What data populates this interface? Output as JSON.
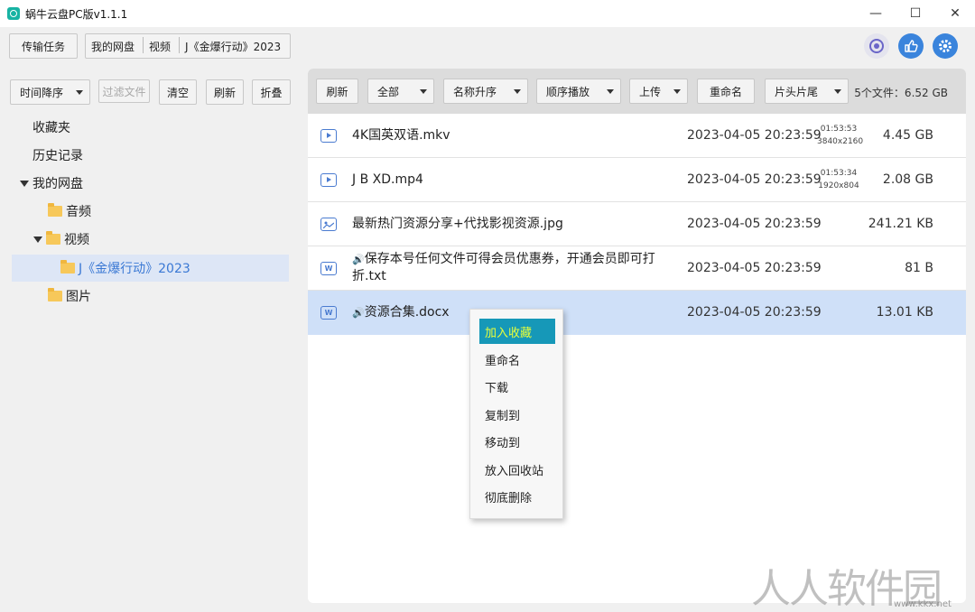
{
  "window": {
    "title": "蜗牛云盘PC版v1.1.1",
    "controls": {
      "minimize": "—",
      "maximize": "☐",
      "close": "✕"
    }
  },
  "toolbar": {
    "transfer_label": "传输任务",
    "breadcrumb": [
      "我的网盘",
      "视频",
      "J《金爆行动》2023"
    ]
  },
  "top_icons": [
    "at-icon",
    "thumbs-up-icon",
    "gear-icon"
  ],
  "left_toolbar": {
    "sort_label": "时间降序",
    "filter_placeholder": "过滤文件",
    "clear_label": "清空",
    "refresh_label": "刷新",
    "collapse_label": "折叠"
  },
  "tree": {
    "favorites": "收藏夹",
    "history": "历史记录",
    "my_disk": "我的网盘",
    "audio": "音频",
    "video": "视频",
    "current": "J《金爆行动》2023",
    "pictures": "图片"
  },
  "right_toolbar": {
    "refresh_label": "刷新",
    "filter_label": "全部",
    "sort_label": "名称升序",
    "play_label": "顺序播放",
    "upload_label": "上传",
    "rename_label": "重命名",
    "segment_label": "片头片尾",
    "file_count": "5个文件：6.52 GB"
  },
  "files": [
    {
      "type": "video",
      "name": "4K国英双语.mkv",
      "date": "2023-04-05 20:23:59",
      "duration": "01:53:53",
      "resolution": "3840x2160",
      "size": "4.45 GB"
    },
    {
      "type": "video",
      "name": "J B XD.mp4",
      "date": "2023-04-05 20:23:59",
      "duration": "01:53:34",
      "resolution": "1920x804",
      "size": "2.08 GB"
    },
    {
      "type": "image",
      "name": "最新热门资源分享+代找影视资源.jpg",
      "date": "2023-04-05 20:23:59",
      "size": "241.21 KB"
    },
    {
      "type": "doc",
      "prefix": "🔊",
      "name": "保存本号任何文件可得会员优惠券，开通会员即可打折.txt",
      "date": "2023-04-05 20:23:59",
      "size": "81 B"
    },
    {
      "type": "doc",
      "prefix": "🔊",
      "name": "资源合集.docx",
      "date": "2023-04-05 20:23:59",
      "size": "13.01 KB"
    }
  ],
  "context_menu": [
    "加入收藏",
    "重命名",
    "下载",
    "复制到",
    "移动到",
    "放入回收站",
    "彻底删除"
  ],
  "watermark": {
    "text": "人人软件园",
    "url": "www.kkx.net"
  },
  "colors": {
    "accent": "#1698b8",
    "selection": "#cfe0f8",
    "tree_selected": "#dde6f6",
    "icon_blue": "#3a78d4"
  }
}
